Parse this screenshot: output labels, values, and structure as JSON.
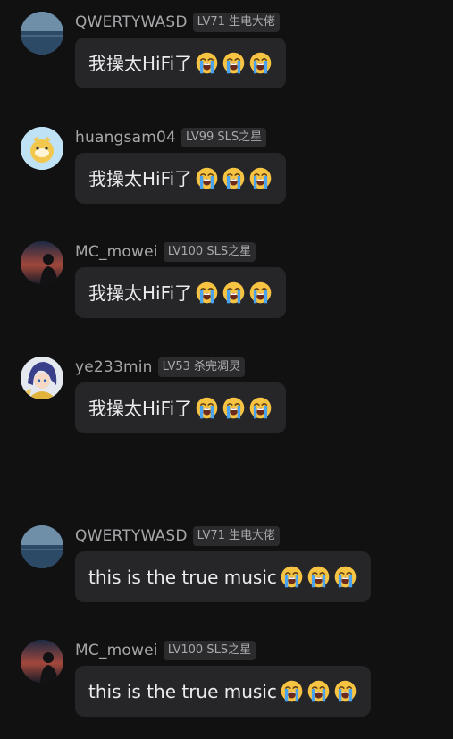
{
  "messages": [
    {
      "username": "QWERTYWASD",
      "badge": "LV71 生电大佬",
      "text": "我操太HiFi了",
      "emoji_icon": "loudly-crying-face-emoji",
      "emoji_count": 3,
      "avatar_icon": "ocean-landscape-avatar"
    },
    {
      "username": "huangsam04",
      "badge": "LV99 SLS之星",
      "text": "我操太HiFi了",
      "emoji_icon": "loudly-crying-face-emoji",
      "emoji_count": 3,
      "avatar_icon": "cartoon-character-avatar"
    },
    {
      "username": "MC_mowei",
      "badge": "LV100 SLS之星",
      "text": "我操太HiFi了",
      "emoji_icon": "loudly-crying-face-emoji",
      "emoji_count": 3,
      "avatar_icon": "sunset-silhouette-avatar"
    },
    {
      "username": "ye233min",
      "badge": "LV53 杀完凋灵",
      "text": "我操太HiFi了",
      "emoji_icon": "loudly-crying-face-emoji",
      "emoji_count": 3,
      "avatar_icon": "anime-character-avatar"
    },
    {
      "username": "QWERTYWASD",
      "badge": "LV71 生电大佬",
      "text": "this is the true music",
      "emoji_icon": "loudly-crying-face-emoji",
      "emoji_count": 3,
      "avatar_icon": "ocean-landscape-avatar"
    },
    {
      "username": "MC_mowei",
      "badge": "LV100 SLS之星",
      "text": "this is the true music",
      "emoji_icon": "loudly-crying-face-emoji",
      "emoji_count": 3,
      "avatar_icon": "sunset-silhouette-avatar"
    }
  ],
  "colors": {
    "background": "#111112",
    "bubble": "#262628",
    "badge": "#2b2b2e",
    "username": "#a7a7aa",
    "text": "#ececee",
    "emoji_face": "#f7c343",
    "emoji_tears": "#4aa3f0"
  }
}
